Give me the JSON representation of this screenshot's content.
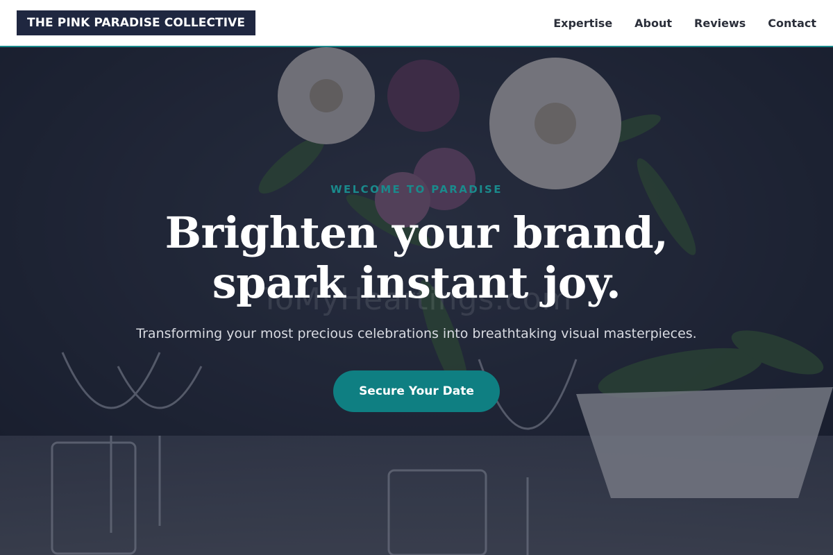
{
  "brand": {
    "name": "THE PINK PARADISE COLLECTIVE"
  },
  "nav": {
    "items": [
      "Expertise",
      "About",
      "Reviews",
      "Contact"
    ]
  },
  "hero": {
    "eyebrow": "WELCOME TO PARADISE",
    "headline_line1": "Brighten your brand,",
    "headline_line2": "spark instant joy.",
    "subtitle": "Transforming your most precious celebrations into breathtaking visual masterpieces.",
    "cta_label": "Secure Your Date",
    "watermark": "ToMyHeartings.com"
  },
  "colors": {
    "accent": "#1a8a8c",
    "button": "#0f7f82",
    "brand_bg": "#1f2740",
    "overlay": "#181e30"
  }
}
